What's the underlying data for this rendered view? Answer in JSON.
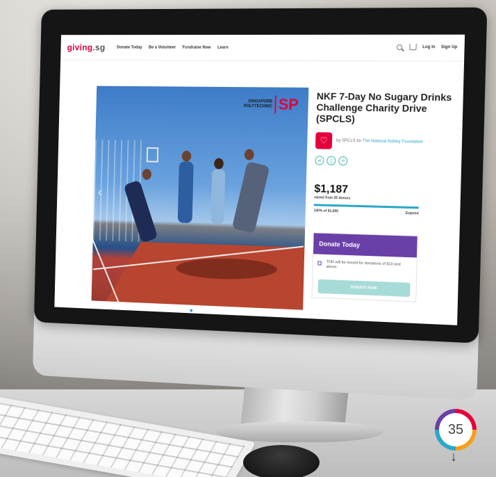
{
  "nav": {
    "logo_prefix": "giving",
    "logo_suffix": ".sg",
    "links": [
      "Donate Today",
      "Be a Volunteer",
      "Fundraise Now",
      "Learn"
    ],
    "login": "Log In",
    "signup": "Sign Up"
  },
  "hero": {
    "brand_line1": "SINGAPORE",
    "brand_line2": "POLYTECHNIC",
    "brand_mark": "SP"
  },
  "campaign": {
    "title": "NKF 7-Day No Sugary Drinks Challenge Charity Drive (SPCLS)",
    "by_prefix": "by SPCLS for",
    "org_name": "The National Kidney Foundation",
    "amount": "$1,187",
    "raised_text": "raised from 25 donors",
    "progress_percent": 100,
    "progress_text": "100% of $1,000",
    "status": "Expired"
  },
  "donate": {
    "header": "Donate Today",
    "tdr_text": "TDR will be issued for donations of $10 and above.",
    "button": "DONATE NOW"
  },
  "page_badge": {
    "number": "35"
  },
  "colors": {
    "brand_red": "#e4003b",
    "purple": "#6b3fa8",
    "teal": "#2aa7c9"
  }
}
